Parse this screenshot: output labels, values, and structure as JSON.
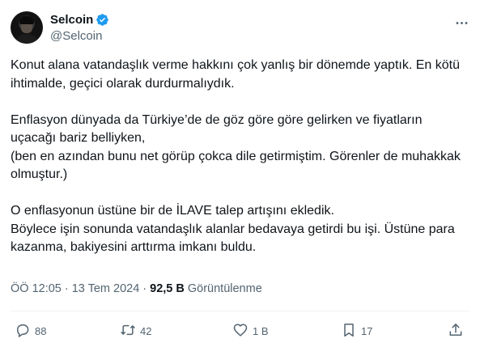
{
  "author": {
    "display_name": "Selcoin",
    "handle": "@Selcoin"
  },
  "tweet": {
    "text": "Konut alana vatandaşlık verme hakkını çok yanlış bir dönemde yaptık. En kötü ihtimalde, geçici olarak durdurmalıydık.\n\nEnflasyon dünyada da Türkiye’de de göz göre göre gelirken ve fiyatların uçacağı bariz belliyken,\n(ben en azından bunu net görüp çokca dile getirmiştim. Görenler de muhakkak olmuştur.)\n\nO enflasyonun üstüne bir de İLAVE talep artışını ekledik.\nBöylece işin sonunda vatandaşlık alanlar bedavaya getirdi bu işi. Üstüne para kazanma, bakiyesini arttırma imkanı buldu."
  },
  "meta": {
    "time": "ÖÖ 12:05",
    "separator": "·",
    "date": "13 Tem 2024",
    "views_count": "92,5 B",
    "views_label": "Görüntülenme"
  },
  "actions": {
    "replies": "88",
    "reposts": "42",
    "likes": "1 B",
    "bookmarks": "17"
  },
  "icons": [
    "verified-badge-icon",
    "more-options-icon",
    "reply-icon",
    "repost-icon",
    "like-icon",
    "bookmark-icon",
    "share-icon"
  ],
  "colors": {
    "text_primary": "#0f1419",
    "text_secondary": "#536471",
    "verified_blue": "#1d9bf0",
    "divider": "#eff3f4"
  }
}
